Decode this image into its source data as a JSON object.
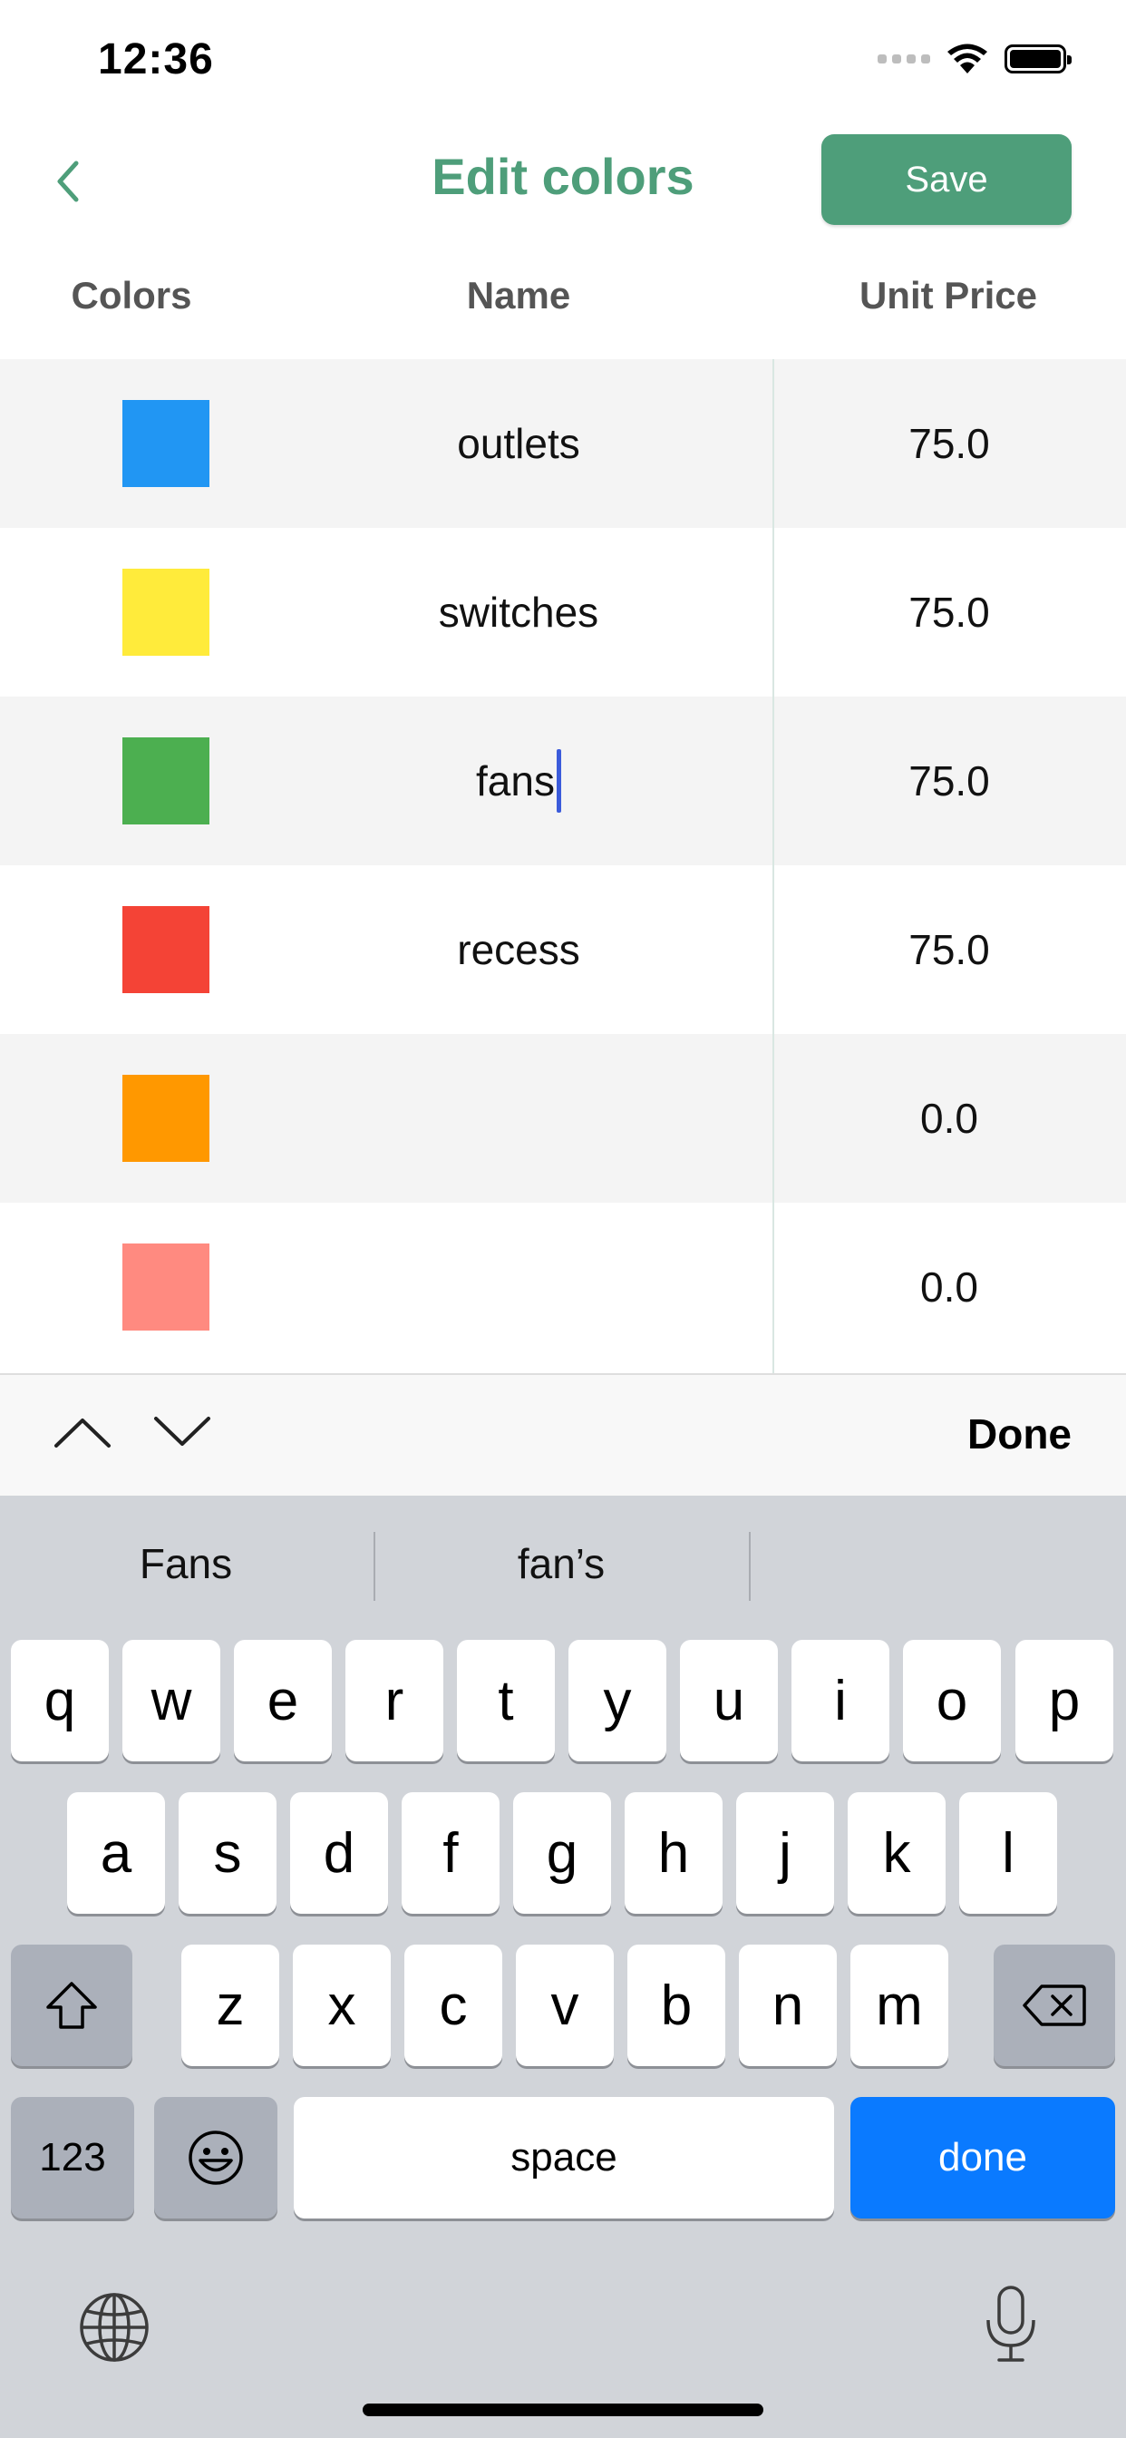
{
  "status_bar": {
    "time": "12:36"
  },
  "nav": {
    "title": "Edit colors",
    "save_label": "Save"
  },
  "table": {
    "headers": {
      "colors": "Colors",
      "name": "Name",
      "unit_price": "Unit Price"
    },
    "rows": [
      {
        "color": "#2196f3",
        "name": "outlets",
        "price": "75.0"
      },
      {
        "color": "#ffeb3b",
        "name": "switches",
        "price": "75.0"
      },
      {
        "color": "#4caf50",
        "name": "fans",
        "price": "75.0"
      },
      {
        "color": "#f44336",
        "name": "recess",
        "price": "75.0"
      },
      {
        "color": "#ff9800",
        "name": "",
        "price": "0.0"
      },
      {
        "color": "#ff8a80",
        "name": "",
        "price": "0.0"
      }
    ]
  },
  "accessory": {
    "done_label": "Done"
  },
  "keyboard": {
    "suggestions": [
      "Fans",
      "fan’s",
      ""
    ],
    "row1": [
      "q",
      "w",
      "e",
      "r",
      "t",
      "y",
      "u",
      "i",
      "o",
      "p"
    ],
    "row2": [
      "a",
      "s",
      "d",
      "f",
      "g",
      "h",
      "j",
      "k",
      "l"
    ],
    "row3": [
      "z",
      "x",
      "c",
      "v",
      "b",
      "n",
      "m"
    ],
    "numbers_label": "123",
    "space_label": "space",
    "done_label": "done"
  },
  "colors": {
    "accent": "#4e9e7a",
    "keyboard_bg": "#d1d4d9",
    "key_blue": "#0a7aff"
  }
}
